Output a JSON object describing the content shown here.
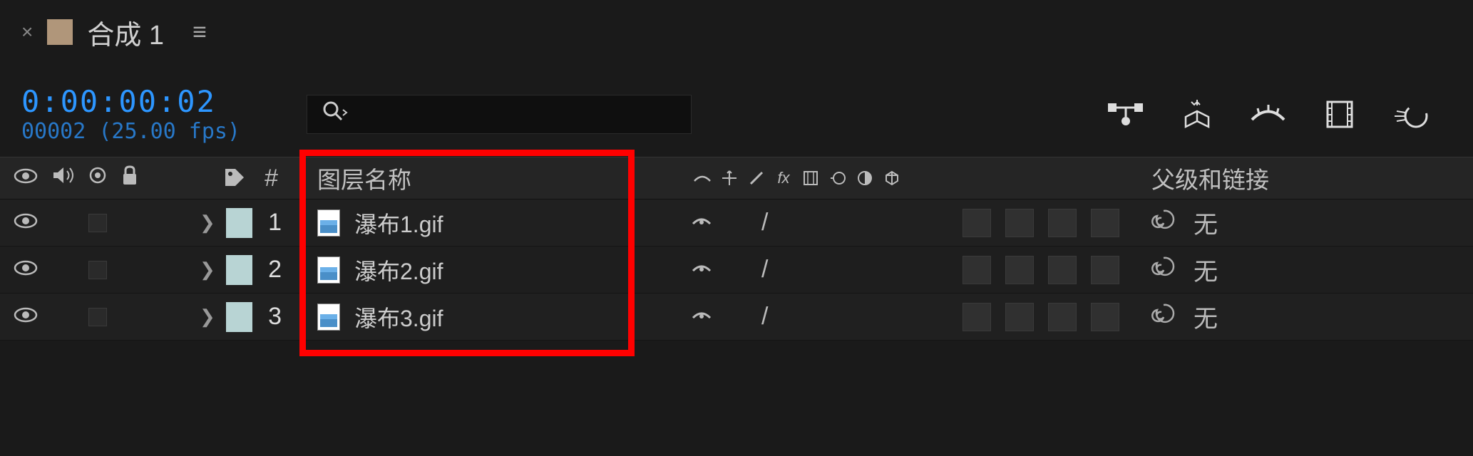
{
  "header": {
    "comp_name": "合成 1",
    "close_symbol": "×",
    "menu_symbol": "≡"
  },
  "time": {
    "timecode": "0:00:00:02",
    "frame_info": "00002 (25.00 fps)"
  },
  "columns": {
    "layer_name": "图层名称",
    "parent_link": "父级和链接",
    "index_symbol": "#"
  },
  "layers": [
    {
      "index": "1",
      "name": "瀑布1.gif",
      "parent": "无"
    },
    {
      "index": "2",
      "name": "瀑布2.gif",
      "parent": "无"
    },
    {
      "index": "3",
      "name": "瀑布3.gif",
      "parent": "无"
    }
  ],
  "icons": {
    "eye": "eye",
    "speaker": "speaker",
    "lock": "lock",
    "label": "label"
  }
}
